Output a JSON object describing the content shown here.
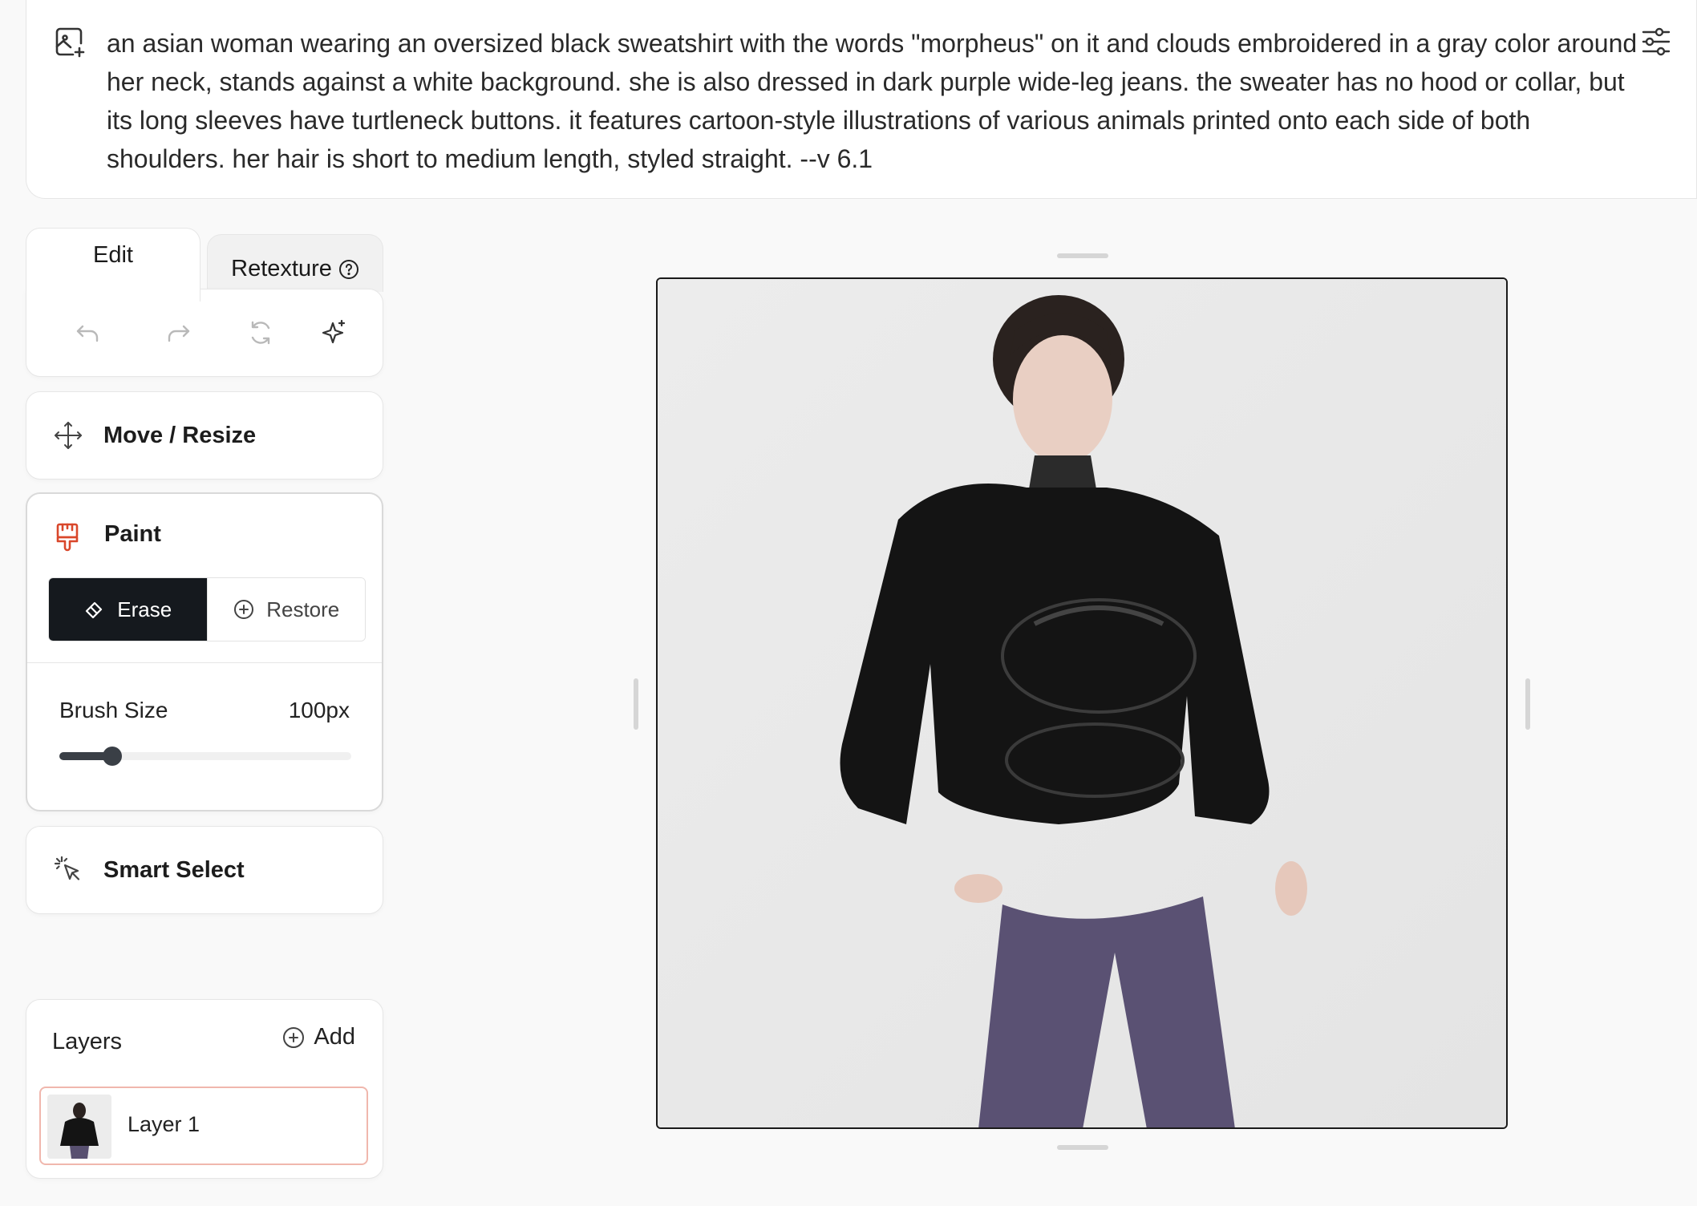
{
  "prompt": {
    "text": "an asian woman wearing an oversized black sweatshirt with the words \"morpheus\" on it and clouds embroidered in a gray color around her neck, stands against a white background. she is also dressed in dark purple wide-leg jeans. the sweater has no hood or collar, but its long sleeves have turtleneck buttons. it features cartoon-style illustrations of various animals printed onto each side of both shoulders. her hair is short to medium length, styled straight. --v 6.1"
  },
  "tabs": {
    "edit": "Edit",
    "retexture": "Retexture"
  },
  "move": {
    "label": "Move / Resize"
  },
  "paint": {
    "label": "Paint",
    "erase": "Erase",
    "restore": "Restore",
    "brush_label": "Brush Size",
    "brush_value": "100px",
    "brush_fraction": 0.18
  },
  "smart_select": {
    "label": "Smart Select"
  },
  "layers": {
    "title": "Layers",
    "add": "Add",
    "items": [
      {
        "label": "Layer 1"
      }
    ]
  },
  "colors": {
    "accent_paint": "#d9472b",
    "active_button": "#15191e",
    "layer_border": "#f0b7ad"
  },
  "icons": {
    "prompt": "image-add-icon",
    "settings": "sliders-icon",
    "undo": "undo-icon",
    "redo": "redo-icon",
    "reset": "refresh-icon",
    "sparkle": "sparkle-icon",
    "move": "move-arrows-icon",
    "paint": "paint-brush-icon",
    "erase": "eraser-icon",
    "restore": "plus-circle-icon",
    "smart_select": "cursor-sparkle-icon",
    "add_layer": "plus-circle-icon"
  }
}
